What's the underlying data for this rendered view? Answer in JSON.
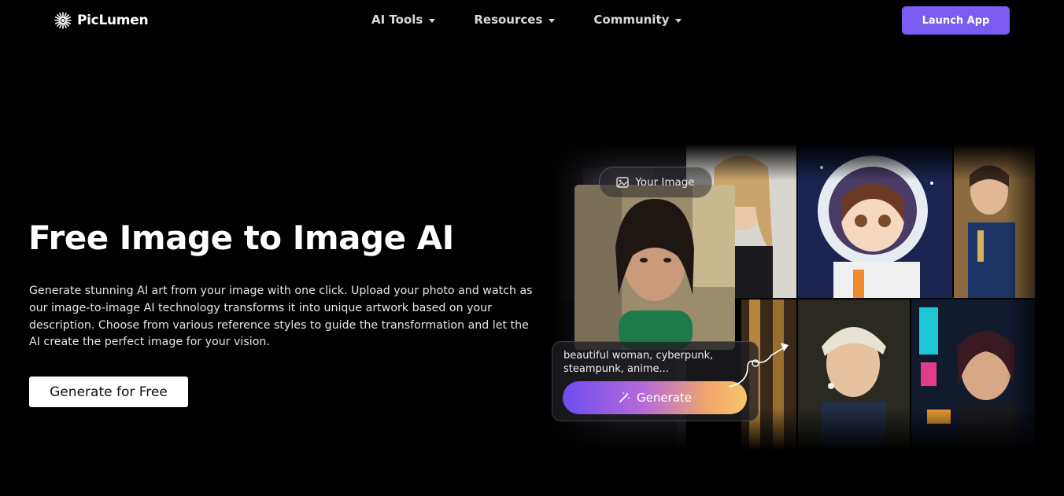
{
  "header": {
    "logo_text": "PicLumen",
    "nav": [
      {
        "label": "AI Tools"
      },
      {
        "label": "Resources"
      },
      {
        "label": "Community"
      }
    ],
    "launch_label": "Launch App"
  },
  "hero": {
    "title": "Free Image to Image AI",
    "description": "Generate stunning AI art from your image with one click. Upload your photo and watch as our image-to-image AI technology transforms it into unique artwork based on your description. Choose from various reference styles to guide the transformation and let the AI create the perfect image for your vision.",
    "cta_label": "Generate for Free"
  },
  "preview": {
    "your_image_label": "Your Image",
    "prompt_text": "beautiful woman, cyberpunk, steampunk, anime...",
    "generate_label": "Generate"
  },
  "colors": {
    "background": "#000000",
    "accent": "#7a5cf0"
  }
}
